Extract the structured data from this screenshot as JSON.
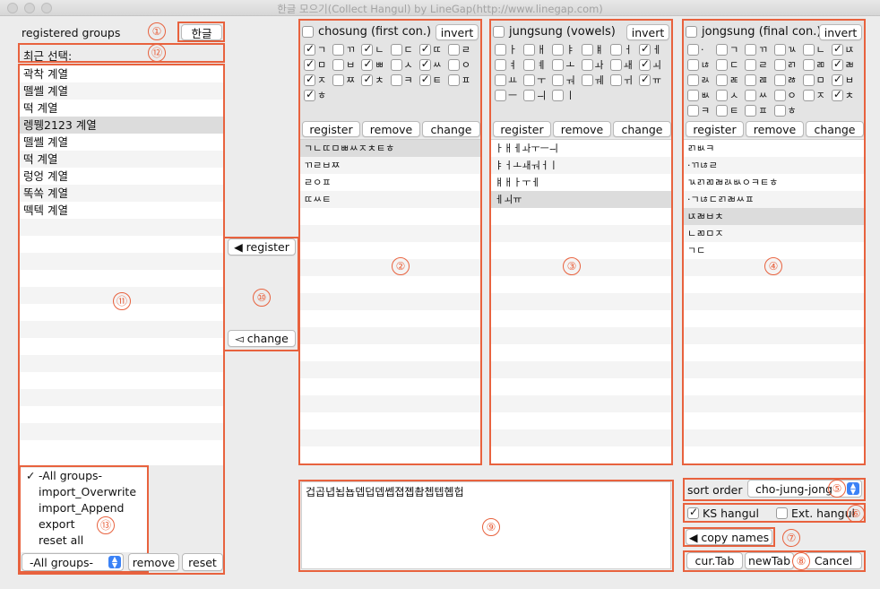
{
  "window": {
    "title": "한글 모으기(Collect Hangul) by LineGap(http://www.linegap.com)"
  },
  "colors": {
    "annotation": "#e8623e",
    "selection": "#dcdcdc",
    "accent": "#3b82f6"
  },
  "left": {
    "header": "registered groups",
    "hangul_button": "한글",
    "recent_label": "최근 선택:",
    "groups": [
      "곽착 계열",
      "뗄쎌 계열",
      "떡 계열",
      "렝뮁2123 계열",
      "뗄쎌 계열",
      "떡 계열",
      "렁엉 계열",
      "똑쏙 계열",
      "떽텍 계열"
    ],
    "selected_index": 3,
    "menu": [
      "-All groups-",
      "import_Overwrite",
      "import_Append",
      "export",
      "reset all"
    ],
    "menu_checked_index": 0,
    "select_value": "-All groups-",
    "remove_label": "remove",
    "reset_label": "reset"
  },
  "middle_buttons": {
    "register": "◀ register",
    "change": "◅ change"
  },
  "panels": [
    {
      "title": "chosung (first con.)",
      "invert": "invert",
      "jamo": [
        {
          "c": "ㄱ",
          "on": true
        },
        {
          "c": "ㄲ",
          "on": false
        },
        {
          "c": "ㄴ",
          "on": true
        },
        {
          "c": "ㄷ",
          "on": false
        },
        {
          "c": "ㄸ",
          "on": true
        },
        {
          "c": "ㄹ",
          "on": false
        },
        {
          "c": "ㅁ",
          "on": true
        },
        {
          "c": "ㅂ",
          "on": false
        },
        {
          "c": "ㅃ",
          "on": true
        },
        {
          "c": "ㅅ",
          "on": false
        },
        {
          "c": "ㅆ",
          "on": true
        },
        {
          "c": "ㅇ",
          "on": false
        },
        {
          "c": "ㅈ",
          "on": true
        },
        {
          "c": "ㅉ",
          "on": false
        },
        {
          "c": "ㅊ",
          "on": true
        },
        {
          "c": "ㅋ",
          "on": false
        },
        {
          "c": "ㅌ",
          "on": true
        },
        {
          "c": "ㅍ",
          "on": false
        },
        {
          "c": "ㅎ",
          "on": true
        }
      ],
      "register": "register",
      "remove": "remove",
      "change": "change",
      "items": [
        "ㄱㄴㄸㅁㅃㅆㅈㅊㅌㅎ",
        "ㄲㄹㅂㅉ",
        "ㄹㅇㅍ",
        "ㄸㅆㅌ"
      ],
      "selected_index": 0
    },
    {
      "title": "jungsung (vowels)",
      "invert": "invert",
      "jamo": [
        {
          "c": "ㅏ",
          "on": false
        },
        {
          "c": "ㅐ",
          "on": false
        },
        {
          "c": "ㅑ",
          "on": false
        },
        {
          "c": "ㅒ",
          "on": false
        },
        {
          "c": "ㅓ",
          "on": false
        },
        {
          "c": "ㅔ",
          "on": true
        },
        {
          "c": "ㅕ",
          "on": false
        },
        {
          "c": "ㅖ",
          "on": false
        },
        {
          "c": "ㅗ",
          "on": false
        },
        {
          "c": "ㅘ",
          "on": false
        },
        {
          "c": "ㅙ",
          "on": false
        },
        {
          "c": "ㅚ",
          "on": true
        },
        {
          "c": "ㅛ",
          "on": false
        },
        {
          "c": "ㅜ",
          "on": false
        },
        {
          "c": "ㅝ",
          "on": false
        },
        {
          "c": "ㅞ",
          "on": false
        },
        {
          "c": "ㅟ",
          "on": false
        },
        {
          "c": "ㅠ",
          "on": true
        },
        {
          "c": "ㅡ",
          "on": false
        },
        {
          "c": "ㅢ",
          "on": false
        },
        {
          "c": "ㅣ",
          "on": false
        }
      ],
      "register": "register",
      "remove": "remove",
      "change": "change",
      "items": [
        "ㅏㅐㅔㅘㅜㅡㅢ",
        "ㅑㅓㅗㅙㅝㅓㅣ",
        "ㅒㅐㅏㅜㅔ",
        "ㅔㅚㅠ"
      ],
      "selected_index": 3
    },
    {
      "title": "jongsung (final con.)",
      "invert": "invert",
      "jamo": [
        {
          "c": "·",
          "on": false
        },
        {
          "c": "ㄱ",
          "on": false
        },
        {
          "c": "ㄲ",
          "on": false
        },
        {
          "c": "ㄳ",
          "on": false
        },
        {
          "c": "ㄴ",
          "on": false
        },
        {
          "c": "ㄵ",
          "on": true
        },
        {
          "c": "ㄶ",
          "on": false
        },
        {
          "c": "ㄷ",
          "on": false
        },
        {
          "c": "ㄹ",
          "on": false
        },
        {
          "c": "ㄺ",
          "on": false
        },
        {
          "c": "ㄻ",
          "on": false
        },
        {
          "c": "ㄼ",
          "on": true
        },
        {
          "c": "ㄽ",
          "on": false
        },
        {
          "c": "ㄾ",
          "on": false
        },
        {
          "c": "ㄿ",
          "on": false
        },
        {
          "c": "ㅀ",
          "on": false
        },
        {
          "c": "ㅁ",
          "on": false
        },
        {
          "c": "ㅂ",
          "on": true
        },
        {
          "c": "ㅄ",
          "on": false
        },
        {
          "c": "ㅅ",
          "on": false
        },
        {
          "c": "ㅆ",
          "on": false
        },
        {
          "c": "ㅇ",
          "on": false
        },
        {
          "c": "ㅈ",
          "on": false
        },
        {
          "c": "ㅊ",
          "on": true
        },
        {
          "c": "ㅋ",
          "on": false
        },
        {
          "c": "ㅌ",
          "on": false
        },
        {
          "c": "ㅍ",
          "on": false
        },
        {
          "c": "ㅎ",
          "on": false
        }
      ],
      "register": "register",
      "remove": "remove",
      "change": "change",
      "items": [
        "ㄺㅄㅋ",
        "·ㄲㄶㄹ",
        "ㄳㄺㄻㄼㄽㅄㅇㅋㅌㅎ",
        "·ㄱㄶㄷㄺㄼㅆㅍ",
        "ㄵㄼㅂㅊ",
        "ㄴㄻㅁㅈ",
        "ㄱㄷ"
      ],
      "selected_index": 4
    }
  ],
  "output_text": "겁곱녑뇝뇹뎁덥뎁쎕졉졥촵쳅텝혭헙",
  "sort_order": {
    "label": "sort order",
    "value": "cho-jung-jong"
  },
  "options": {
    "ks_label": "KS hangul",
    "ks_on": true,
    "ext_label": "Ext. hangul",
    "ext_on": false
  },
  "copy_names": "◀ copy names",
  "bottom_buttons": {
    "cur_tab": "cur.Tab",
    "new_tab": "newTab",
    "cancel": "Cancel"
  },
  "annotations": [
    "①",
    "②",
    "③",
    "④",
    "⑤",
    "⑥",
    "⑦",
    "⑧",
    "⑨",
    "⑩",
    "⑪",
    "⑫",
    "⑬"
  ]
}
